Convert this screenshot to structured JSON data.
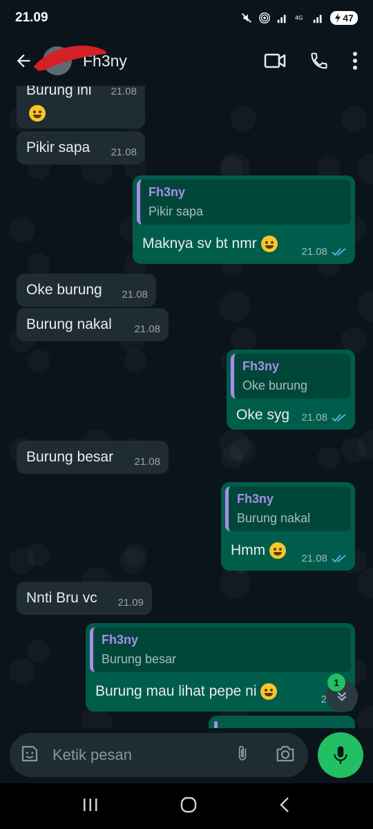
{
  "status_bar": {
    "time": "21.09",
    "battery": "47"
  },
  "header": {
    "contact_name": "Fh3ny"
  },
  "messages": [
    {
      "dir": "in",
      "text": "Burung ini",
      "time": "21.08",
      "has_emoji": true
    },
    {
      "dir": "in",
      "text": "Pikir sapa",
      "time": "21.08"
    },
    {
      "dir": "out",
      "quote_name": "Fh3ny",
      "quote_text": "Pikir sapa",
      "text": "Maknya sv bt nmr",
      "time": "21.08"
    },
    {
      "dir": "in",
      "text": "Oke burung",
      "time": "21.08"
    },
    {
      "dir": "in",
      "text": "Burung nakal",
      "time": "21.08"
    },
    {
      "dir": "out",
      "quote_name": "Fh3ny",
      "quote_text": "Oke burung",
      "text": "Oke syg",
      "time": "21.08"
    },
    {
      "dir": "in",
      "text": "Burung besar",
      "time": "21.08"
    },
    {
      "dir": "out",
      "quote_name": "Fh3ny",
      "quote_text": "Burung nakal",
      "text": "Hmm",
      "time": "21.08"
    },
    {
      "dir": "in",
      "text": "Nnti Bru vc",
      "time": "21.09"
    },
    {
      "dir": "out",
      "quote_name": "Fh3ny",
      "quote_text": "Burung besar",
      "text": "Burung mau lihat pepe ni",
      "time": "21.09"
    }
  ],
  "scroll_badge": "1",
  "composer": {
    "placeholder": "Ketik pesan"
  },
  "colors": {
    "incoming": "#202c33",
    "outgoing": "#005c4b",
    "accent": "#21c063",
    "quote_name": "#a98de8",
    "read_ticks": "#53bdeb"
  },
  "icons": [
    "back-arrow-icon",
    "video-call-icon",
    "phone-icon",
    "more-vert-icon",
    "sticker-icon",
    "attach-icon",
    "camera-icon",
    "mic-icon",
    "chevron-double-down-icon",
    "recents-icon",
    "home-icon",
    "back-nav-icon"
  ]
}
